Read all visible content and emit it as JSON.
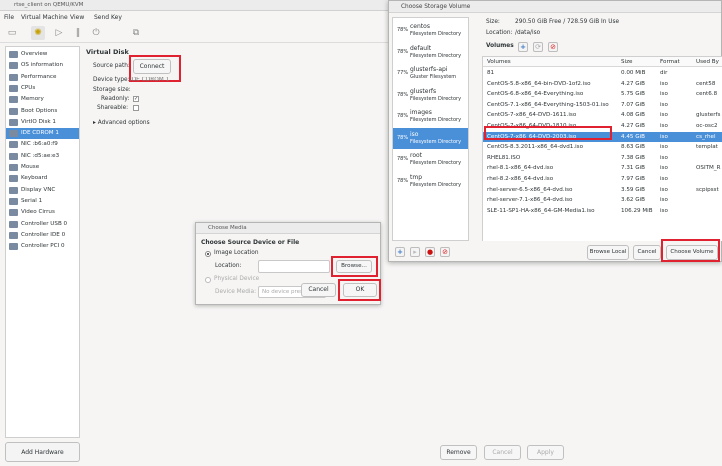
{
  "window": {
    "title": "rtse_client on QEMU/KVM"
  },
  "menu": [
    "File",
    "Virtual Machine",
    "View",
    "Send Key"
  ],
  "sidebar": {
    "items": [
      {
        "label": "Overview"
      },
      {
        "label": "OS information"
      },
      {
        "label": "Performance"
      },
      {
        "label": "CPUs"
      },
      {
        "label": "Memory"
      },
      {
        "label": "Boot Options"
      },
      {
        "label": "VirtIO Disk 1"
      },
      {
        "label": "IDE CDROM 1"
      },
      {
        "label": "NIC :b6:a0:f9"
      },
      {
        "label": "NIC :d5:ae:e3"
      },
      {
        "label": "Mouse"
      },
      {
        "label": "Keyboard"
      },
      {
        "label": "Display VNC"
      },
      {
        "label": "Serial 1"
      },
      {
        "label": "Video Cirrus"
      },
      {
        "label": "Controller USB 0"
      },
      {
        "label": "Controller IDE 0"
      },
      {
        "label": "Controller PCI 0"
      }
    ],
    "add_hardware": "Add Hardware"
  },
  "disk": {
    "heading": "Virtual Disk",
    "source_path_label": "Source path:",
    "connect_button": "Connect",
    "device_type_label": "Device type:",
    "device_type_value": "IDE CDROM 1",
    "storage_size_label": "Storage size:",
    "readonly_label": "Readonly:",
    "shareable_label": "Shareable:",
    "advanced": "Advanced options"
  },
  "footer": {
    "remove": "Remove",
    "cancel": "Cancel",
    "apply": "Apply"
  },
  "media_dialog": {
    "title": "Choose Media",
    "heading": "Choose Source Device or File",
    "image_location": "Image Location",
    "location_label": "Location:",
    "browse": "Browse...",
    "physical_device": "Physical Device",
    "device_media_label": "Device Media:",
    "device_media_value": "No device present",
    "cancel": "Cancel",
    "ok": "OK"
  },
  "storage_dialog": {
    "title": "Choose Storage Volume",
    "pools": [
      {
        "pct": "78%",
        "name": "centos",
        "type": "Filesystem Directory"
      },
      {
        "pct": "78%",
        "name": "default",
        "type": "Filesystem Directory"
      },
      {
        "pct": "77%",
        "name": "glusterfs-api",
        "type": "Gluster Filesystem"
      },
      {
        "pct": "78%",
        "name": "glusterfs",
        "type": "Filesystem Directory"
      },
      {
        "pct": "78%",
        "name": "images",
        "type": "Filesystem Directory"
      },
      {
        "pct": "78%",
        "name": "iso",
        "type": "Filesystem Directory"
      },
      {
        "pct": "78%",
        "name": "root",
        "type": "Filesystem Directory"
      },
      {
        "pct": "78%",
        "name": "tmp",
        "type": "Filesystem Directory"
      }
    ],
    "size_label": "Size:",
    "size_value": "290.50 GiB Free / 728.59 GiB In Use",
    "location_label": "Location:",
    "location_value": "/data/iso",
    "volumes_label": "Volumes",
    "columns": [
      "Volumes",
      "Size",
      "Format",
      "Used By"
    ],
    "rows": [
      [
        "81",
        "0.00 MiB",
        "dir",
        ""
      ],
      [
        "CentOS-5.8-x86_64-bin-DVD-1of2.iso",
        "4.27 GiB",
        "iso",
        "cent58"
      ],
      [
        "CentOS-6.8-x86_64-Everything.iso",
        "5.75 GiB",
        "iso",
        "cent6.8"
      ],
      [
        "CentOS-7.1-x86_64-Everything-1503-01.iso",
        "7.07 GiB",
        "iso",
        ""
      ],
      [
        "CentOS-7-x86_64-DVD-1611.iso",
        "4.08 GiB",
        "iso",
        "glusterfs"
      ],
      [
        "CentOS-7-x86_64-DVD-1810.iso",
        "4.27 GiB",
        "iso",
        "oc-osc2"
      ],
      [
        "CentOS-7-x86_64-DVD-2003.iso",
        "4.45 GiB",
        "iso",
        "cs_rhel"
      ],
      [
        "CentOS-8.3.2011-x86_64-dvd1.iso",
        "8.63 GiB",
        "iso",
        "templat"
      ],
      [
        "RHEL81.ISO",
        "7.38 GiB",
        "iso",
        ""
      ],
      [
        "rhel-8.1-x86_64-dvd.iso",
        "7.31 GiB",
        "iso",
        "OSITM_R"
      ],
      [
        "rhel-8.2-x86_64-dvd.iso",
        "7.97 GiB",
        "iso",
        ""
      ],
      [
        "rhel-server-6.5-x86_64-dvd.iso",
        "3.59 GiB",
        "iso",
        "scpipsst"
      ],
      [
        "rhel-server-7.1-x86_64-dvd.iso",
        "3.62 GiB",
        "iso",
        ""
      ],
      [
        "SLE-11-SP1-HA-x86_64-GM-Media1.iso",
        "106.29 MiB",
        "iso",
        ""
      ]
    ],
    "browse_local": "Browse Local",
    "cancel": "Cancel",
    "choose_volume": "Choose Volume"
  },
  "colors": {
    "accent": "#4a90d9",
    "highlight": "#e0212f"
  }
}
